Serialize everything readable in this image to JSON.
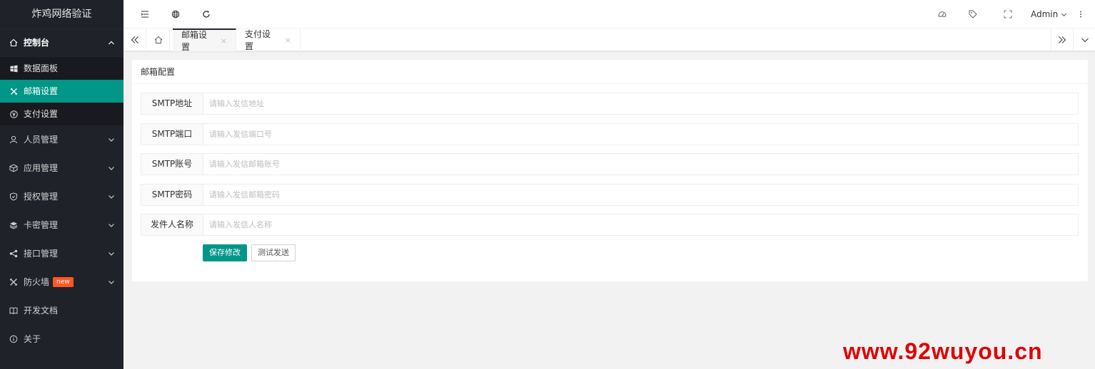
{
  "app": {
    "title": "炸鸡网络验证"
  },
  "sidebar": {
    "console": {
      "label": "控制台"
    },
    "console_items": [
      {
        "label": "数据面板",
        "icon": "windows-icon"
      },
      {
        "label": "邮箱设置",
        "icon": "cross-icon"
      },
      {
        "label": "支付设置",
        "icon": "yen-circle-icon"
      }
    ],
    "items": [
      {
        "label": "人员管理",
        "icon": "user-icon"
      },
      {
        "label": "应用管理",
        "icon": "cube-icon"
      },
      {
        "label": "授权管理",
        "icon": "shield-icon"
      },
      {
        "label": "卡密管理",
        "icon": "layers-icon"
      },
      {
        "label": "接口管理",
        "icon": "share-icon"
      },
      {
        "label": "防火墙",
        "icon": "cross-icon",
        "badge": "new"
      },
      {
        "label": "开发文档",
        "icon": "book-icon"
      },
      {
        "label": "关于",
        "icon": "info-icon"
      }
    ]
  },
  "header": {
    "user": "Admin"
  },
  "tabs": [
    {
      "label": "邮箱设置",
      "close": "×"
    },
    {
      "label": "支付设置",
      "close": "×"
    }
  ],
  "form": {
    "title": "邮箱配置",
    "fields": [
      {
        "label": "SMTP地址",
        "placeholder": "请输入发信地址",
        "value": ""
      },
      {
        "label": "SMTP端口",
        "placeholder": "请输入发信端口号",
        "value": ""
      },
      {
        "label": "SMTP账号",
        "placeholder": "请输入发信邮箱账号",
        "value": ""
      },
      {
        "label": "SMTP密码",
        "placeholder": "请输入发信邮箱密码",
        "value": ""
      },
      {
        "label": "发件人名称",
        "placeholder": "请输入发信人名称",
        "value": ""
      }
    ],
    "save_label": "保存修改",
    "test_label": "测试发送"
  },
  "watermark": "www.92wuyou.cn",
  "colors": {
    "accent": "#009688",
    "sidebar_bg": "#20222a",
    "badge": "#ff5722",
    "watermark": "#e00000"
  }
}
